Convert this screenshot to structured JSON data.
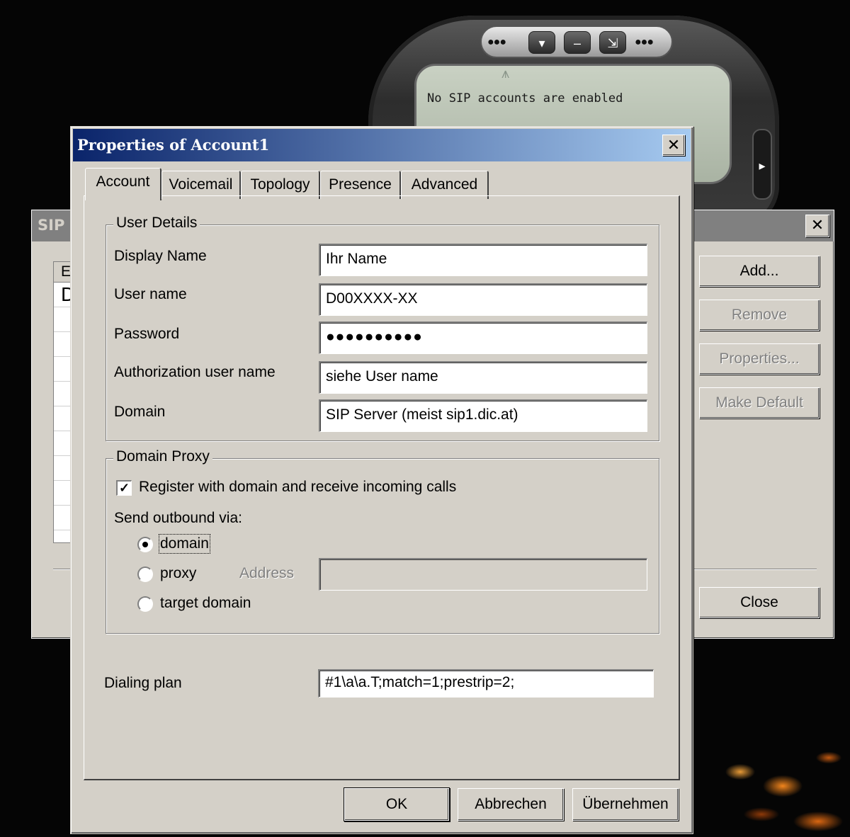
{
  "phone": {
    "status": "No SIP accounts are enabled",
    "buttons": [
      "▾",
      "–",
      "⇲"
    ],
    "side_arrow": "▸"
  },
  "sip_window": {
    "title": "SIP",
    "list_header": "E",
    "list_first_row": "D",
    "buttons": {
      "add": "Add...",
      "remove": "Remove",
      "properties": "Properties...",
      "make_default": "Make Default",
      "close": "Close"
    }
  },
  "dialog": {
    "title": "Properties of Account1",
    "tabs": [
      "Account",
      "Voicemail",
      "Topology",
      "Presence",
      "Advanced"
    ],
    "active_tab": "Account",
    "user_details": {
      "legend": "User Details",
      "fields": [
        {
          "label": "Display Name",
          "value": "Ihr Name"
        },
        {
          "label": "User name",
          "value": "D00XXXX-XX"
        },
        {
          "label": "Password",
          "value": "●●●●●●●●●●"
        },
        {
          "label": "Authorization user name",
          "value": "siehe User name"
        },
        {
          "label": "Domain",
          "value": "SIP Server (meist sip1.dic.at)"
        }
      ]
    },
    "domain_proxy": {
      "legend": "Domain Proxy",
      "register_label": "Register with domain and receive incoming calls",
      "register_checked": true,
      "send_outbound_label": "Send outbound via:",
      "options": [
        "domain",
        "proxy",
        "target domain"
      ],
      "selected_option": "domain",
      "address_label": "Address",
      "address_value": ""
    },
    "dialing_plan": {
      "label": "Dialing plan",
      "value": "#1\\a\\a.T;match=1;prestrip=2;"
    },
    "buttons": {
      "ok": "OK",
      "cancel": "Abbrechen",
      "apply": "Übernehmen"
    }
  }
}
